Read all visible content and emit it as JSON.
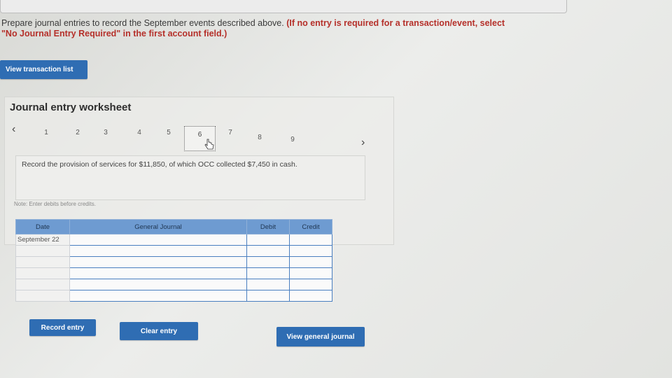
{
  "instruction": {
    "text": "Prepare journal entries to record the September events described above.",
    "red_text": "(If no entry is required for a transaction/event, select",
    "bold_text": "\"No Journal Entry Required\" in the first account field.)"
  },
  "buttons": {
    "view_transaction_list": "View transaction list",
    "record_entry": "Record entry",
    "clear_entry": "Clear entry",
    "view_general_journal": "View general journal"
  },
  "worksheet": {
    "title": "Journal entry worksheet",
    "steps": [
      "1",
      "2",
      "3",
      "4",
      "5",
      "6",
      "7",
      "8",
      "9"
    ],
    "active_step": "6",
    "description": "Record the provision of services for $11,850, of which OCC collected $7,450 in cash.",
    "note": "Note: Enter debits before credits."
  },
  "journal": {
    "headers": {
      "date": "Date",
      "account": "General Journal",
      "debit": "Debit",
      "credit": "Credit"
    },
    "rows": [
      {
        "date": "September 22"
      },
      {
        "date": ""
      },
      {
        "date": ""
      },
      {
        "date": ""
      },
      {
        "date": ""
      },
      {
        "date": ""
      }
    ]
  },
  "colors": {
    "accent": "#2f6db3",
    "header": "#6e9bd1",
    "alert": "#b5302a"
  }
}
